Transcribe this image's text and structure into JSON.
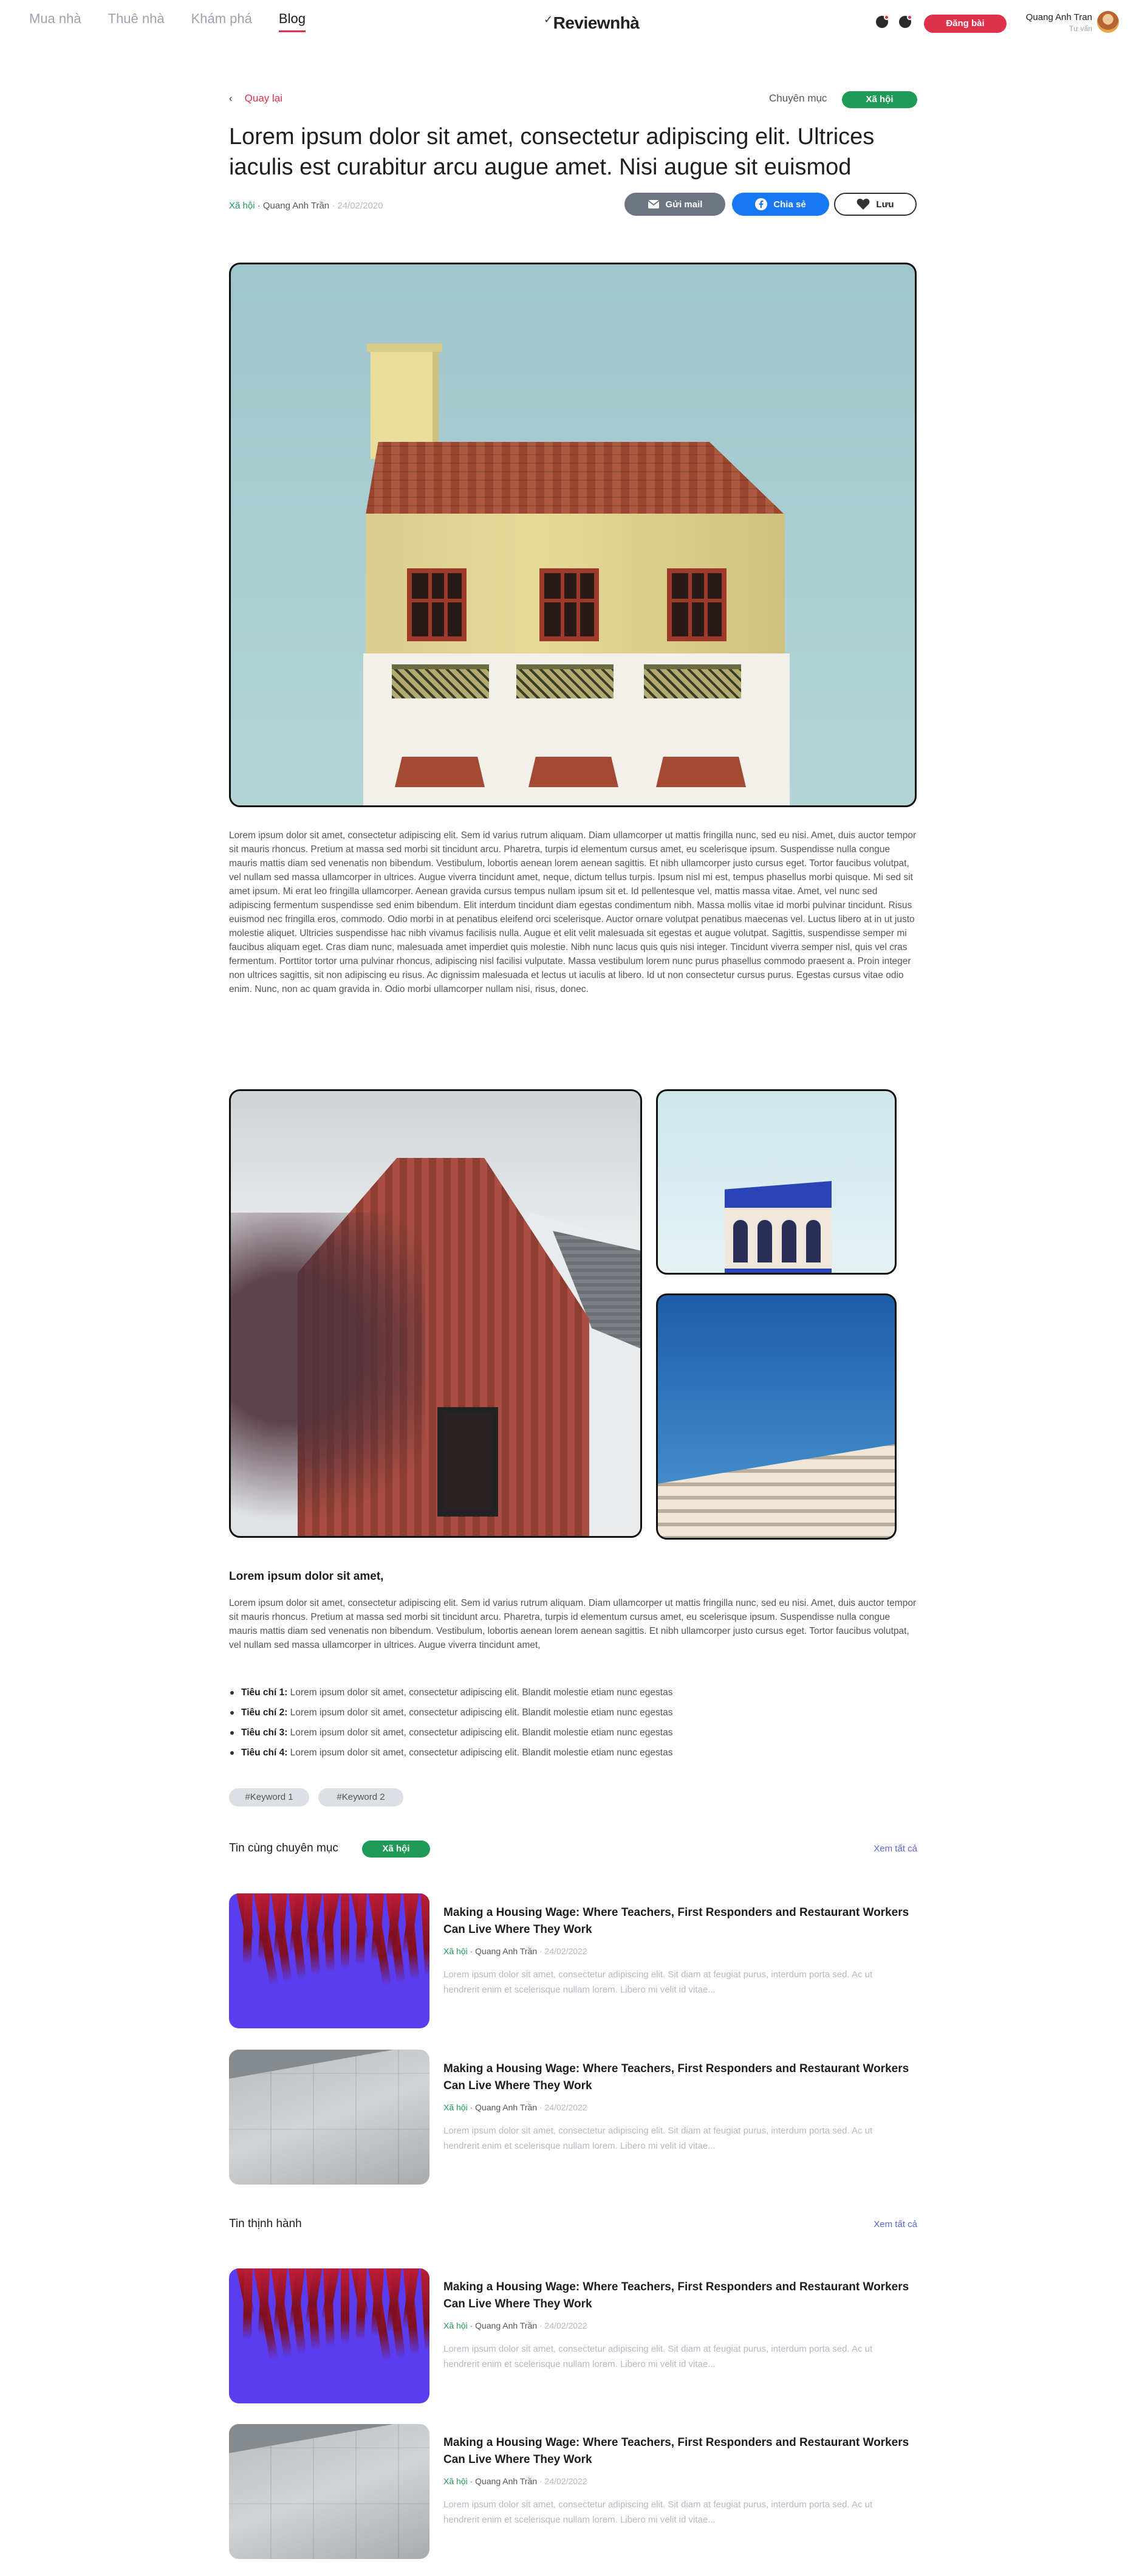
{
  "nav": {
    "items": [
      "Mua nhà",
      "Thuê nhà",
      "Khám phá",
      "Blog"
    ],
    "active": "Blog"
  },
  "brand": {
    "logo": "Reviewnhà"
  },
  "header": {
    "post_button": "Đăng bài",
    "user_name": "Quang Anh Tran",
    "user_role": "Tư vấn",
    "icons": [
      "notification-icon",
      "message-icon"
    ]
  },
  "article": {
    "back_label": "Quay lại",
    "category_label": "Chuyên mục",
    "category": "Xã hội",
    "title": "Lorem ipsum dolor sit amet, consectetur adipiscing elit. Ultrices iaculis est curabitur arcu augue amet. Nisi augue sit euismod",
    "meta_category": "Xã hội",
    "meta_author": "· Quang Anh Trần",
    "meta_date": "· 24/02/2020",
    "actions": {
      "mail": "Gửi mail",
      "share": "Chia sẻ",
      "save": "Lưu"
    },
    "paragraph_1": "Lorem ipsum dolor sit amet, consectetur adipiscing elit. Sem id varius rutrum aliquam. Diam ullamcorper ut mattis fringilla nunc, sed eu nisi. Amet, duis auctor tempor sit mauris rhoncus. Pretium at massa sed morbi sit tincidunt arcu. Pharetra, turpis id elementum cursus amet, eu scelerisque ipsum. Suspendisse nulla congue mauris mattis diam sed venenatis non bibendum. Vestibulum, lobortis aenean lorem aenean sagittis. Et nibh ullamcorper justo cursus eget. Tortor faucibus volutpat, vel nullam sed massa ullamcorper in ultrices. Augue viverra tincidunt amet, neque, dictum tellus turpis. Ipsum nisl mi est, tempus phasellus morbi quisque. Mi sed sit amet ipsum. Mi erat leo fringilla ullamcorper. Aenean gravida cursus tempus nullam ipsum sit et. Id pellentesque vel, mattis massa vitae. Amet, vel nunc sed adipiscing fermentum suspendisse sed enim bibendum. Elit interdum tincidunt diam egestas condimentum nibh. Massa mollis vitae id morbi pulvinar tincidunt. Risus euismod nec fringilla eros, commodo. Odio morbi in at penatibus eleifend orci scelerisque. Auctor ornare volutpat penatibus maecenas vel. Luctus libero at in ut justo molestie aliquet. Ultricies suspendisse hac nibh vivamus facilisis nulla. Augue et elit velit malesuada sit egestas et augue volutpat. Sagittis, suspendisse semper mi faucibus aliquam eget. Cras diam nunc, malesuada amet imperdiet quis molestie. Nibh nunc lacus quis quis nisi integer. Tincidunt viverra semper nisl, quis vel cras fermentum. Porttitor tortor urna pulvinar rhoncus, adipiscing nisl facilisi vulputate. Massa vestibulum lorem nunc purus phasellus commodo praesent a. Proin integer non ultrices sagittis, sit non adipiscing eu risus. Ac dignissim malesuada et lectus ut iaculis at libero. Id ut non consectetur cursus purus. Egestas cursus vitae odio enim. Nunc, non ac quam gravida in. Odio morbi ullamcorper nullam nisi, risus, donec.",
    "subheading": "Lorem ipsum dolor sit amet,",
    "paragraph_2": "Lorem ipsum dolor sit amet, consectetur adipiscing elit. Sem id varius rutrum aliquam. Diam ullamcorper ut mattis fringilla nunc, sed eu nisi. Amet, duis auctor tempor sit mauris rhoncus. Pretium at massa sed morbi sit tincidunt arcu. Pharetra, turpis id elementum cursus amet, eu scelerisque ipsum. Suspendisse nulla congue mauris mattis diam sed venenatis non bibendum. Vestibulum, lobortis aenean lorem aenean sagittis. Et nibh ullamcorper justo cursus eget. Tortor faucibus volutpat, vel nullam sed massa ullamcorper in ultrices. Augue viverra tincidunt amet,",
    "criteria": [
      {
        "label": "Tiêu chí 1:",
        "text": " Lorem ipsum dolor sit amet, consectetur adipiscing elit. Blandit molestie etiam nunc egestas"
      },
      {
        "label": "Tiêu chí 2:",
        "text": " Lorem ipsum dolor sit amet, consectetur adipiscing elit. Blandit molestie etiam nunc egestas"
      },
      {
        "label": "Tiêu chí 3:",
        "text": " Lorem ipsum dolor sit amet, consectetur adipiscing elit. Blandit molestie etiam nunc egestas"
      },
      {
        "label": "Tiêu chí 4:",
        "text": " Lorem ipsum dolor sit amet, consectetur adipiscing elit. Blandit molestie etiam nunc egestas"
      }
    ],
    "keywords": [
      "#Keyword 1",
      "#Keyword 2"
    ]
  },
  "related": {
    "title": "Tin cùng chuyên mục",
    "badge": "Xã hội",
    "see_all": "Xem tất cả",
    "items": [
      {
        "title": "Making a Housing Wage: Where Teachers, First Responders and Restaurant Workers Can Live Where They Work",
        "category": "Xã hội",
        "author": " · Quang Anh Trần",
        "date": " · 24/02/2022",
        "excerpt": "Lorem ipsum dolor sit amet, consectetur adipiscing elit. Sit diam at feugiat purus, interdum porta sed. Ac ut hendrerit enim et scelerisque nullam lorem. Libero mi velit id vitae..."
      },
      {
        "title": "Making a Housing Wage: Where Teachers, First Responders and Restaurant Workers Can Live Where They Work",
        "category": "Xã hội",
        "author": " · Quang Anh Trần",
        "date": " · 24/02/2022",
        "excerpt": "Lorem ipsum dolor sit amet, consectetur adipiscing elit. Sit diam at feugiat purus, interdum porta sed. Ac ut hendrerit enim et scelerisque nullam lorem. Libero mi velit id vitae..."
      }
    ]
  },
  "trending": {
    "title": "Tin thịnh hành",
    "see_all": "Xem tất cả",
    "items": [
      {
        "title": "Making a Housing Wage: Where Teachers, First Responders and Restaurant Workers Can Live Where They Work",
        "category": "Xã hội",
        "author": " · Quang Anh Trần",
        "date": " · 24/02/2022",
        "excerpt": "Lorem ipsum dolor sit amet, consectetur adipiscing elit. Sit diam at feugiat purus, interdum porta sed. Ac ut hendrerit enim et scelerisque nullam lorem. Libero mi velit id vitae..."
      },
      {
        "title": "Making a Housing Wage: Where Teachers, First Responders and Restaurant Workers Can Live Where They Work",
        "category": "Xã hội",
        "author": " · Quang Anh Trần",
        "date": " · 24/02/2022",
        "excerpt": "Lorem ipsum dolor sit amet, consectetur adipiscing elit. Sit diam at feugiat purus, interdum porta sed. Ac ut hendrerit enim et scelerisque nullam lorem. Libero mi velit id vitae..."
      }
    ]
  },
  "colors": {
    "accent": "#e0314a",
    "category": "#1f9b57",
    "link": "#5a67d8",
    "facebook": "#1877f2"
  }
}
